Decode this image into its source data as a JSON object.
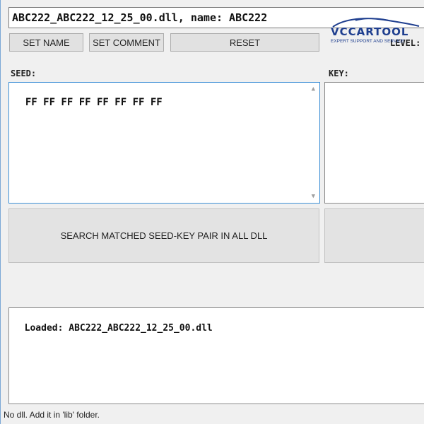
{
  "file_field": {
    "value": "ABC222_ABC222_12_25_00.dll, name: ABC222"
  },
  "toolbar": {
    "set_name_label": "SET NAME",
    "set_comment_label": "SET COMMENT",
    "reset_label": "RESET"
  },
  "level_label": "LEVEL:",
  "seed": {
    "label": "SEED:",
    "value": "FF FF FF FF FF FF FF FF"
  },
  "key": {
    "label": "KEY:",
    "value": ""
  },
  "search_button_label": "SEARCH MATCHED SEED-KEY PAIR IN ALL DLL",
  "log": {
    "value": "Loaded: ABC222_ABC222_12_25_00.dll"
  },
  "status_bar": "No dll. Add it in 'lib' folder.",
  "watermark": {
    "brand": "VCCARTOOL",
    "tagline": "EXPERT SUPPORT AND SERVICE"
  },
  "colors": {
    "focus_border": "#3c8fd6",
    "logo_blue": "#1f3f8f"
  }
}
